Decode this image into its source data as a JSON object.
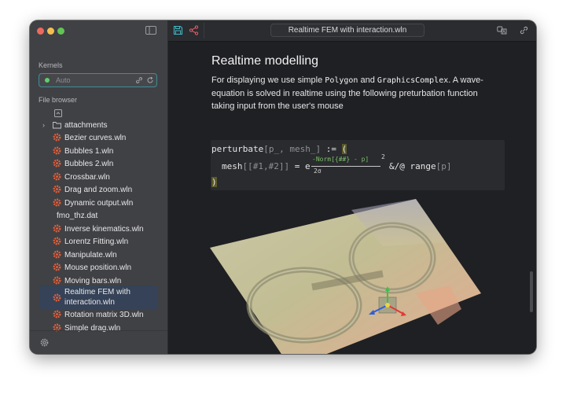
{
  "window": {
    "title": "Realtime FEM with interaction.wln"
  },
  "sidebar": {
    "kernels_title": "Kernels",
    "kernel_value": "Auto",
    "file_browser_title": "File browser",
    "files": [
      {
        "type": "folder",
        "label": "attachments"
      },
      {
        "type": "file",
        "label": "Bezier curves.wln"
      },
      {
        "type": "file",
        "label": "Bubbles 1.wln"
      },
      {
        "type": "file",
        "label": "Bubbles 2.wln"
      },
      {
        "type": "file",
        "label": "Crossbar.wln"
      },
      {
        "type": "file",
        "label": "Drag and zoom.wln"
      },
      {
        "type": "file",
        "label": "Dynamic output.wln"
      },
      {
        "type": "plain",
        "label": "fmo_thz.dat"
      },
      {
        "type": "file",
        "label": "Inverse kinematics.wln"
      },
      {
        "type": "file",
        "label": "Lorentz Fitting.wln"
      },
      {
        "type": "file",
        "label": "Manipulate.wln"
      },
      {
        "type": "file",
        "label": "Mouse position.wln"
      },
      {
        "type": "file",
        "label": "Moving bars.wln"
      },
      {
        "type": "file",
        "label": "Realtime FEM with",
        "label2": "interaction.wln",
        "active": true
      },
      {
        "type": "file",
        "label": "Rotation matrix 3D.wln"
      },
      {
        "type": "file",
        "label": "Simple drag.wln"
      }
    ]
  },
  "notebook": {
    "heading": "Realtime modelling",
    "para_1": "For displaying we use simple ",
    "para_code_1": "Polygon",
    "para_2": " and ",
    "para_code_2": "GraphicsComplex",
    "para_3": ". A wave-equation is solved in realtime using the following preturbation function taking input from the user's mouse",
    "code": {
      "l1_a": "perturbate",
      "l1_b": "[p_, mesh_]",
      "l1_c": " := ",
      "l1_d": "(",
      "l2_a": "mesh",
      "l2_b": "[[#1,#2]]",
      "l2_c": " = e",
      "l2_exp": "-Norm[{##} - p]",
      "l2_sq": "2",
      "l2_den": "2σ",
      "l2_d": " &/@ range",
      "l2_e": "[p]",
      "l3": ")"
    }
  },
  "colors": {
    "accent": "#3d8d97",
    "kernel_status": "#5fd06a",
    "file_icon": "#e8603a",
    "active_row": "#354257"
  },
  "icons": {
    "toolbar": [
      "save-icon",
      "share-icon",
      "translate-icon",
      "link-icon"
    ],
    "kernel": [
      "link-icon",
      "refresh-icon"
    ],
    "sidebar_toggle": "sidebar-toggle-icon",
    "settings": "gear-icon",
    "file": "wolfram-file-icon",
    "folder": "folder-icon"
  }
}
